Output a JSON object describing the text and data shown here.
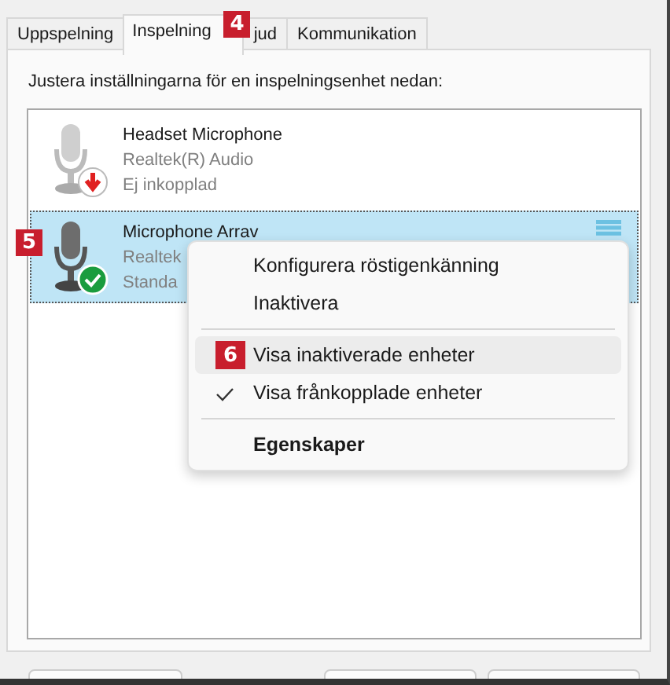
{
  "tabs": [
    {
      "label": "Uppspelning",
      "selected": false
    },
    {
      "label": "Inspelning",
      "selected": true
    },
    {
      "label": "jud",
      "selected": false,
      "badge": "4"
    },
    {
      "label": "Kommunikation",
      "selected": false
    }
  ],
  "instruction": "Justera inställningarna för en inspelningsenhet nedan:",
  "devices": [
    {
      "name": "Headset Microphone",
      "driver": "Realtek(R) Audio",
      "status_text": "Ej inkopplad",
      "kind": "unplugged",
      "selected": false
    },
    {
      "name": "Microphone Arrav",
      "driver": "Realtek",
      "status_text": "Standa",
      "kind": "default",
      "selected": true,
      "badge": "5"
    }
  ],
  "context_menu": {
    "sections": [
      [
        {
          "label": "Konfigurera röstigenkänning",
          "checked": false,
          "selected": false,
          "default": false
        },
        {
          "label": "Inaktivera",
          "checked": false,
          "selected": false,
          "default": false
        }
      ],
      [
        {
          "label": "Visa inaktiverade enheter",
          "checked": false,
          "selected": true,
          "default": false,
          "badge": "6"
        },
        {
          "label": "Visa frånkopplade enheter",
          "checked": true,
          "selected": false,
          "default": false
        }
      ],
      [
        {
          "label": "Egenskaper",
          "checked": false,
          "selected": false,
          "default": true
        }
      ]
    ]
  }
}
